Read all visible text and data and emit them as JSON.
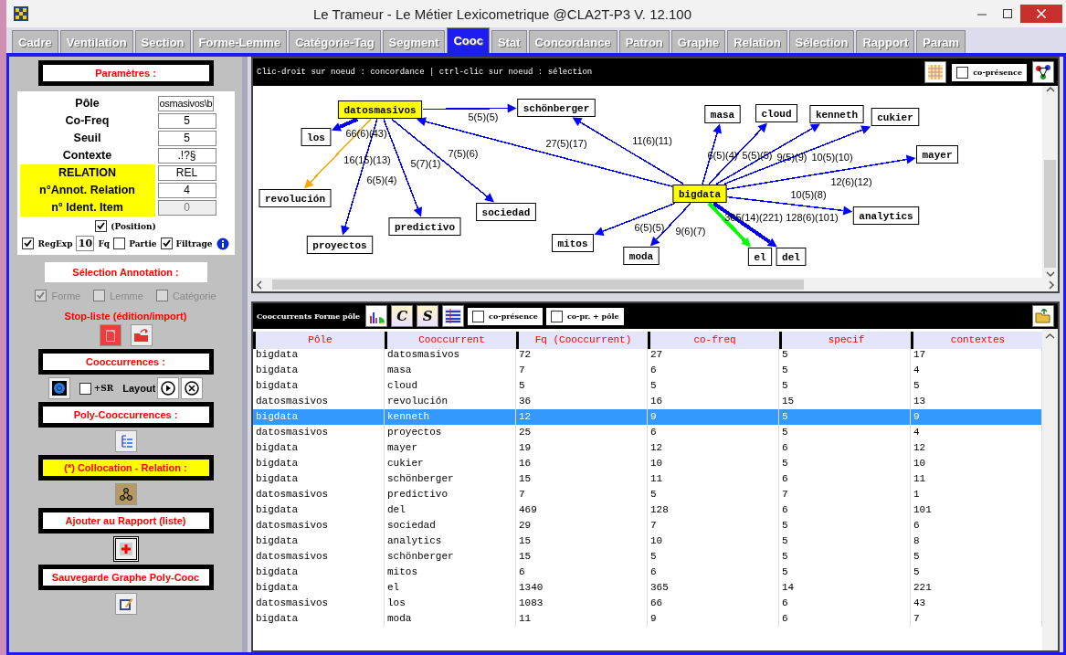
{
  "window": {
    "title": "Le Trameur - Le Métier Lexicometrique @CLA2T-P3 V. 12.100"
  },
  "tabs": [
    {
      "label": "Cadre",
      "selected": false
    },
    {
      "label": "Ventilation",
      "selected": false
    },
    {
      "label": "Section",
      "selected": false
    },
    {
      "label": "Forme-Lemme",
      "selected": false
    },
    {
      "label": "Catégorie-Tag",
      "selected": false
    },
    {
      "label": "Segment",
      "selected": false
    },
    {
      "label": "Cooc",
      "selected": true
    },
    {
      "label": "Stat",
      "selected": false
    },
    {
      "label": "Concordance",
      "selected": false
    },
    {
      "label": "Patron",
      "selected": false
    },
    {
      "label": "Graphe",
      "selected": false
    },
    {
      "label": "Relation",
      "selected": false
    },
    {
      "label": "Sélection",
      "selected": false
    },
    {
      "label": "Rapport",
      "selected": false
    },
    {
      "label": "Param",
      "selected": false
    }
  ],
  "parameters": {
    "title": "Paramètres :",
    "fields": [
      {
        "label": "Pôle",
        "value": "osmasivos\\b",
        "highlight": false,
        "disabled": false
      },
      {
        "label": "Co-Freq",
        "value": "5",
        "highlight": false,
        "disabled": false
      },
      {
        "label": "Seuil",
        "value": "5",
        "highlight": false,
        "disabled": false
      },
      {
        "label": "Contexte",
        "value": ".!?§",
        "highlight": false,
        "disabled": false
      },
      {
        "label": "RELATION",
        "value": "REL",
        "highlight": true,
        "disabled": false
      },
      {
        "label": "n°Annot. Relation",
        "value": "4",
        "highlight": true,
        "disabled": false
      },
      {
        "label": "n° Ident. Item",
        "value": "0",
        "highlight": true,
        "disabled": true
      }
    ],
    "position": {
      "label": "(Position)",
      "checked": true
    },
    "regexp": {
      "label": "RegExp",
      "checked": true
    },
    "fq": {
      "value": "10",
      "label": "Fq"
    },
    "partie": {
      "label": "Partie",
      "checked": false
    },
    "filtrage": {
      "label": "Filtrage",
      "checked": true
    }
  },
  "annotation": {
    "title": "Sélection Annotation :",
    "options": [
      {
        "label": "Forme",
        "checked": true,
        "disabled": true
      },
      {
        "label": "Lemme",
        "checked": false,
        "disabled": true
      },
      {
        "label": "Catégorie",
        "checked": false,
        "disabled": true
      }
    ]
  },
  "stoplist": {
    "title": "Stop-liste (édition/import)"
  },
  "cooccurrences": {
    "title": "Cooccurrences :",
    "sr": {
      "label": "+SR",
      "checked": false
    },
    "layout": "Layout"
  },
  "poly": {
    "title": "Poly-Cooccurrences :"
  },
  "collocation": {
    "title": "(*) Collocation - Relation :"
  },
  "rapport": {
    "title": "Ajouter au Rapport (liste)"
  },
  "sauvegarde": {
    "title": "Sauvegarde Graphe Poly-Cooc"
  },
  "graph": {
    "hint": "Clic-droit sur noeud : concordance | ctrl-clic sur noeud : sélection",
    "copresence": {
      "label": "co-présence",
      "checked": false
    },
    "nodes": [
      {
        "label": "datosmasivos",
        "pole": true
      },
      {
        "label": "schönberger",
        "pole": false
      },
      {
        "label": "los",
        "pole": false
      },
      {
        "label": "revolución",
        "pole": false
      },
      {
        "label": "proyectos",
        "pole": false
      },
      {
        "label": "predictivo",
        "pole": false
      },
      {
        "label": "sociedad",
        "pole": false
      },
      {
        "label": "masa",
        "pole": false
      },
      {
        "label": "cloud",
        "pole": false
      },
      {
        "label": "kenneth",
        "pole": false
      },
      {
        "label": "cukier",
        "pole": false
      },
      {
        "label": "mayer",
        "pole": false
      },
      {
        "label": "bigdata",
        "pole": true
      },
      {
        "label": "analytics",
        "pole": false
      },
      {
        "label": "mitos",
        "pole": false
      },
      {
        "label": "moda",
        "pole": false
      },
      {
        "label": "el",
        "pole": false
      },
      {
        "label": "del",
        "pole": false
      }
    ],
    "edges": [
      {
        "label": "5(5)(5)",
        "color": "#0000ff",
        "kind": "thin"
      },
      {
        "label": "66(6)(43)",
        "color": "#0000ff",
        "kind": "thick"
      },
      {
        "label": "16(15)(13)",
        "color": "#ffa500",
        "kind": "thin"
      },
      {
        "label": "6(5)(4)",
        "color": "#0000ff",
        "kind": "thin"
      },
      {
        "label": "5(7)(1)",
        "color": "#0000ff",
        "kind": "thin"
      },
      {
        "label": "7(5)(6)",
        "color": "#0000ff",
        "kind": "thin"
      },
      {
        "label": "27(5)(17)",
        "color": "#0000ff",
        "kind": "thin"
      },
      {
        "label": "11(6)(11)",
        "color": "#0000ff",
        "kind": "thin"
      },
      {
        "label": "6(5)(4)",
        "color": "#0000ff",
        "kind": "thin"
      },
      {
        "label": "5(5)(5)",
        "color": "#0000ff",
        "kind": "thin"
      },
      {
        "label": "9(5)(9)",
        "color": "#0000ff",
        "kind": "thin"
      },
      {
        "label": "10(5)(10)",
        "color": "#0000ff",
        "kind": "thin"
      },
      {
        "label": "12(6)(12)",
        "color": "#0000ff",
        "kind": "thin"
      },
      {
        "label": "10(5)(8)",
        "color": "#0000ff",
        "kind": "thin"
      },
      {
        "label": "6(5)(5)",
        "color": "#0000ff",
        "kind": "thin"
      },
      {
        "label": "9(6)(7)",
        "color": "#0000ff",
        "kind": "thin"
      },
      {
        "label": "365(14)(221)",
        "color": "#00ff00",
        "kind": "thick"
      },
      {
        "label": "128(6)(101)",
        "color": "#0000ff",
        "kind": "thick"
      }
    ]
  },
  "table": {
    "title": "Cooccurrents Forme pôle",
    "tools": [
      {
        "kind": "chart"
      },
      {
        "kind": "letter",
        "letter": "C"
      },
      {
        "kind": "letter",
        "letter": "S"
      },
      {
        "kind": "list"
      }
    ],
    "toggles": [
      {
        "label": "co-présence",
        "checked": false
      },
      {
        "label": "co-pr. + pôle",
        "checked": false
      }
    ],
    "columns": [
      "Pôle",
      "Cooccurrent",
      "Fq (Cooccurrent)",
      "co-freq",
      "specif",
      "contextes"
    ],
    "rows": [
      {
        "cells": [
          "bigdata",
          "datosmasivos",
          "72",
          "27",
          "5",
          "17"
        ],
        "selected": false
      },
      {
        "cells": [
          "bigdata",
          "masa",
          "7",
          "6",
          "5",
          "4"
        ],
        "selected": false
      },
      {
        "cells": [
          "bigdata",
          "cloud",
          "5",
          "5",
          "5",
          "5"
        ],
        "selected": false
      },
      {
        "cells": [
          "datosmasivos",
          "revolución",
          "36",
          "16",
          "15",
          "13"
        ],
        "selected": false
      },
      {
        "cells": [
          "bigdata",
          "kenneth",
          "12",
          "9",
          "5",
          "9"
        ],
        "selected": true
      },
      {
        "cells": [
          "datosmasivos",
          "proyectos",
          "25",
          "6",
          "5",
          "4"
        ],
        "selected": false
      },
      {
        "cells": [
          "bigdata",
          "mayer",
          "19",
          "12",
          "6",
          "12"
        ],
        "selected": false
      },
      {
        "cells": [
          "bigdata",
          "cukier",
          "16",
          "10",
          "5",
          "10"
        ],
        "selected": false
      },
      {
        "cells": [
          "bigdata",
          "schönberger",
          "15",
          "11",
          "6",
          "11"
        ],
        "selected": false
      },
      {
        "cells": [
          "datosmasivos",
          "predictivo",
          "7",
          "5",
          "7",
          "1"
        ],
        "selected": false
      },
      {
        "cells": [
          "bigdata",
          "del",
          "469",
          "128",
          "6",
          "101"
        ],
        "selected": false
      },
      {
        "cells": [
          "datosmasivos",
          "sociedad",
          "29",
          "7",
          "5",
          "6"
        ],
        "selected": false
      },
      {
        "cells": [
          "bigdata",
          "analytics",
          "15",
          "10",
          "5",
          "8"
        ],
        "selected": false
      },
      {
        "cells": [
          "datosmasivos",
          "schönberger",
          "15",
          "5",
          "5",
          "5"
        ],
        "selected": false
      },
      {
        "cells": [
          "bigdata",
          "mitos",
          "6",
          "6",
          "5",
          "5"
        ],
        "selected": false
      },
      {
        "cells": [
          "bigdata",
          "el",
          "1340",
          "365",
          "14",
          "221"
        ],
        "selected": false
      },
      {
        "cells": [
          "datosmasivos",
          "los",
          "1083",
          "66",
          "6",
          "43"
        ],
        "selected": false
      },
      {
        "cells": [
          "bigdata",
          "moda",
          "11",
          "9",
          "6",
          "7"
        ],
        "selected": false
      }
    ]
  }
}
